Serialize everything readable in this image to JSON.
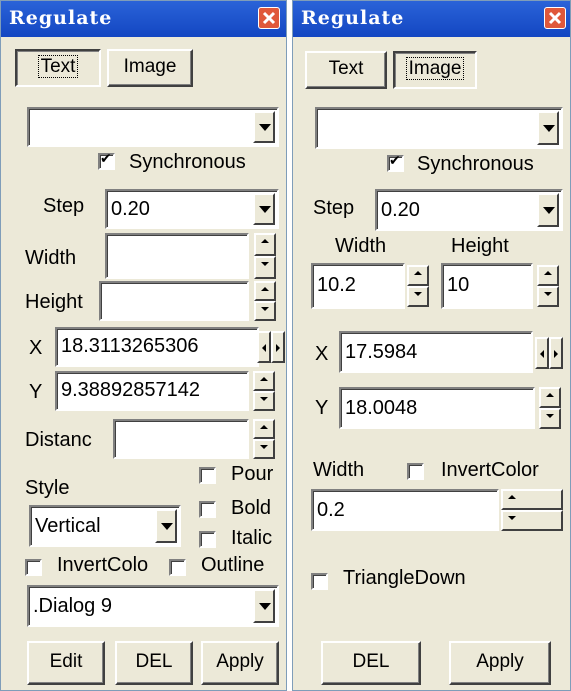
{
  "left": {
    "title": "Regulate",
    "tabs": [
      "Text",
      "Image"
    ],
    "combo_value": "",
    "synchronous": "Synchronous",
    "step_label": "Step",
    "step_value": "0.20",
    "width_label": "Width",
    "width_value": "",
    "height_label": "Height",
    "height_value": "",
    "x_label": "X",
    "x_value": "18.3113265306",
    "y_label": "Y",
    "y_value": "9.38892857142",
    "distance_label": "Distanc",
    "distance_value": "",
    "style_label": "Style",
    "style_value": "Vertical",
    "pour_label": "Pour",
    "bold_label": "Bold",
    "italic_label": "Italic",
    "invert_label": "InvertColo",
    "outline_label": "Outline",
    "font_value": ".Dialog 9",
    "edit_label": "Edit",
    "del_label": "DEL",
    "apply_label": "Apply"
  },
  "right": {
    "title": "Regulate",
    "tabs": [
      "Text",
      "Image"
    ],
    "combo_value": "",
    "synchronous": "Synchronous",
    "step_label": "Step",
    "step_value": "0.20",
    "width_label": "Width",
    "height_label": "Height",
    "width_value": "10.2",
    "height_value": "10",
    "x_label": "X",
    "x_value": "17.5984",
    "y_label": "Y",
    "y_value": "18.0048",
    "line_width_label": "Width",
    "invert_label": "InvertColor",
    "line_width_value": "0.2",
    "triangle_label": "TriangleDown",
    "del_label": "DEL",
    "apply_label": "Apply"
  },
  "colors": {
    "titlebar": "#1a4fcf",
    "panel": "#ece9d8",
    "close": "#e0583a"
  }
}
